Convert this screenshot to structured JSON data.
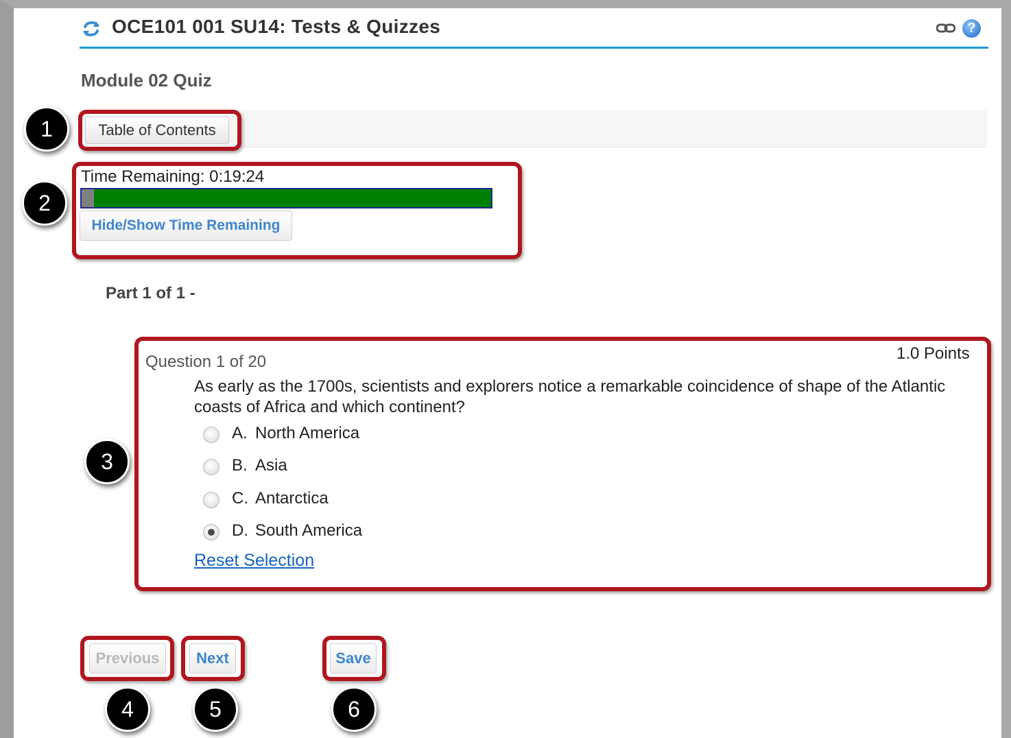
{
  "header": {
    "title": "OCE101 001 SU14: Tests & Quizzes",
    "tool_icon": "refresh-arrows-icon",
    "actions": [
      {
        "name": "link-icon"
      },
      {
        "name": "help-icon",
        "glyph": "?"
      }
    ]
  },
  "quiz": {
    "title": "Module 02 Quiz",
    "toc_label": "Table of Contents"
  },
  "timer": {
    "label": "Time Remaining: 0:19:24",
    "elapsed_fraction": 0.03,
    "toggle_label": "Hide/Show Time Remaining"
  },
  "part": {
    "heading": "Part 1 of 1 -"
  },
  "question": {
    "counter": "Question 1 of 20",
    "points": "1.0 Points",
    "text": "As early as the 1700s, scientists and explorers notice a remarkable coincidence of shape of the Atlantic coasts of Africa and which continent?",
    "answers": [
      {
        "letter": "A.",
        "text": "North America",
        "selected": false
      },
      {
        "letter": "B.",
        "text": "Asia",
        "selected": false
      },
      {
        "letter": "C.",
        "text": "Antarctica",
        "selected": false
      },
      {
        "letter": "D.",
        "text": "South America",
        "selected": true
      }
    ],
    "reset_label": "Reset Selection"
  },
  "navigation": {
    "previous_label": "Previous",
    "next_label": "Next",
    "save_label": "Save"
  },
  "callouts": [
    "1",
    "2",
    "3",
    "4",
    "5",
    "6"
  ],
  "colors": {
    "accent": "#1a9ad6",
    "timer_remaining": "#008000",
    "timer_elapsed": "#808080",
    "callout_border": "#b0161e",
    "button_text": "#3d86cc"
  }
}
